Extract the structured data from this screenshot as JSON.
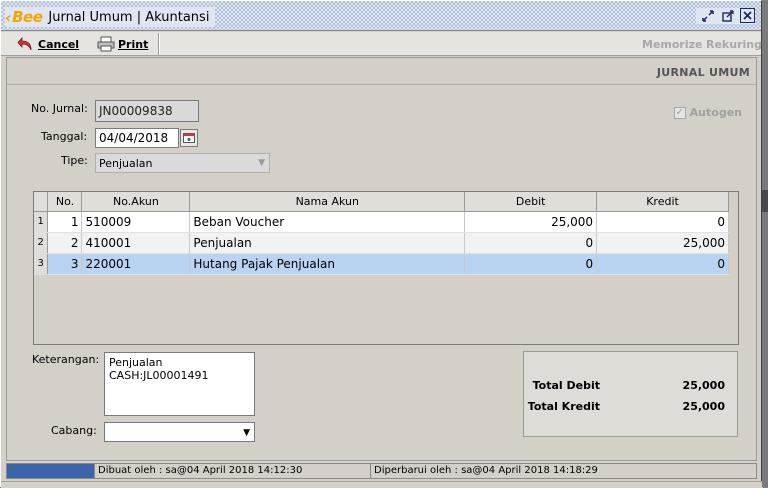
{
  "window": {
    "logo_text": "Bee",
    "title": "Jurnal Umum | Akuntansi",
    "controls": [
      "restore-icon",
      "maximize-icon",
      "close-icon"
    ]
  },
  "toolbar": {
    "cancel_label": "Cancel",
    "print_label": "Print",
    "memorize_label": "Memorize",
    "rekuring_label": "Rekuring"
  },
  "header": {
    "title": "JURNAL UMUM"
  },
  "form": {
    "no_jurnal_label": "No. Jurnal:",
    "no_jurnal_value": "JN00009838",
    "tanggal_label": "Tanggal:",
    "tanggal_value": "04/04/2018",
    "tipe_label": "Tipe:",
    "tipe_value": "Penjualan",
    "autogen_label": "Autogen",
    "autogen_checked": true
  },
  "table": {
    "columns": [
      "No.",
      "No.Akun",
      "Nama Akun",
      "Debit",
      "Kredit"
    ],
    "rows": [
      {
        "rownum": "1",
        "no": "1",
        "akun": "510009",
        "nama": "Beban Voucher",
        "debit": "25,000",
        "kredit": "0"
      },
      {
        "rownum": "2",
        "no": "2",
        "akun": "410001",
        "nama": "Penjualan",
        "debit": "0",
        "kredit": "25,000"
      },
      {
        "rownum": "3",
        "no": "3",
        "akun": "220001",
        "nama": "Hutang Pajak Penjualan",
        "debit": "0",
        "kredit": "0"
      }
    ]
  },
  "keterangan": {
    "label": "Keterangan:",
    "value": "Penjualan CASH:JL00001491"
  },
  "cabang": {
    "label": "Cabang:",
    "value": ""
  },
  "totals": {
    "debit_label": "Total Debit",
    "debit_value": "25,000",
    "kredit_label": "Total Kredit",
    "kredit_value": "25,000"
  },
  "status": {
    "dibuat": "Dibuat oleh : sa@04 April 2018  14:12:30",
    "diperbarui": "Diperbarui oleh : sa@04 April 2018  14:18:29"
  },
  "colors": {
    "selected_row": "#b8d4f2",
    "logo": "#f4a500",
    "status_accent": "#3c64a8"
  }
}
